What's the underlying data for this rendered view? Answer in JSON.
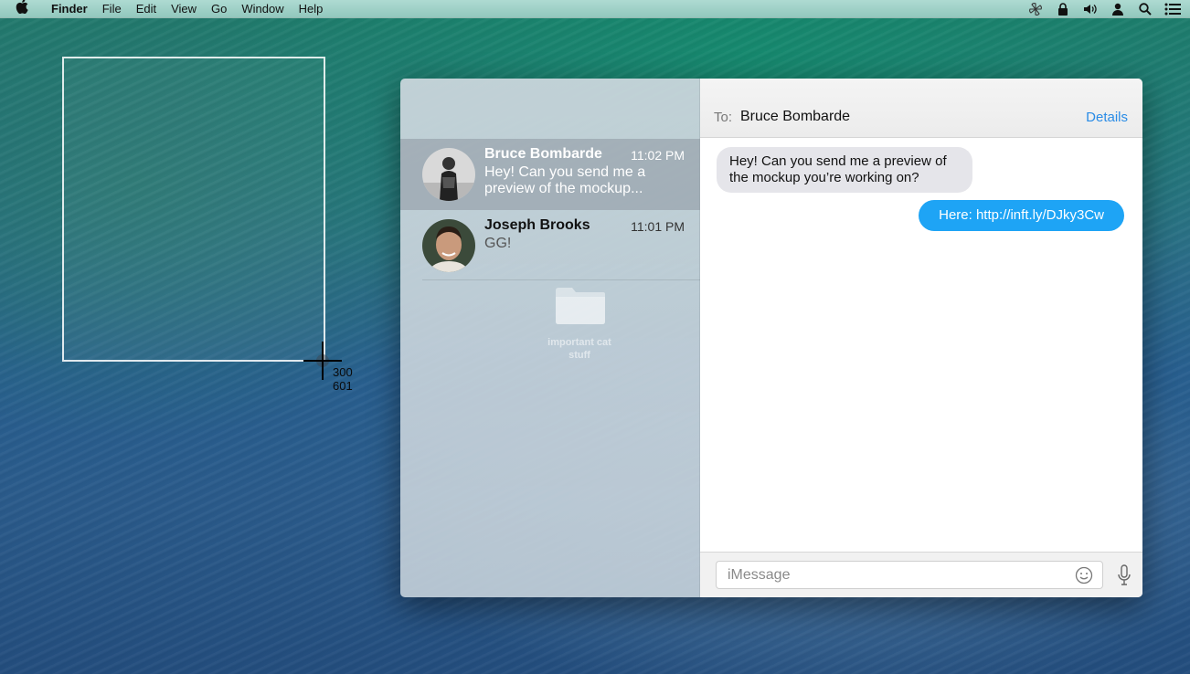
{
  "menubar": {
    "app_name": "Finder",
    "items": [
      "File",
      "Edit",
      "View",
      "Go",
      "Window",
      "Help"
    ],
    "status_icons": [
      "pinwheel-icon",
      "lock-icon",
      "volume-icon",
      "user-icon",
      "spotlight-icon",
      "notification-center-icon"
    ]
  },
  "screenshot_tool": {
    "coord_x": "300",
    "coord_y": "601"
  },
  "desktop": {
    "folder_label": "important cat stuff"
  },
  "messages": {
    "conversations": [
      {
        "name": "Bruce Bombarde",
        "time": "11:02 PM",
        "preview": "Hey! Can you send me a preview of the mockup...",
        "selected": true
      },
      {
        "name": "Joseph Brooks",
        "time": "11:01 PM",
        "preview": "GG!",
        "selected": false
      }
    ],
    "header": {
      "to_label": "To:",
      "recipient": "Bruce Bombarde",
      "details_label": "Details"
    },
    "thread": [
      {
        "direction": "incoming",
        "text": "Hey! Can you send me a preview of the mockup you’re working on?"
      },
      {
        "direction": "outgoing",
        "text": "Here: http://inft.ly/DJky3Cw"
      }
    ],
    "composer": {
      "placeholder": "iMessage"
    }
  },
  "colors": {
    "accent": "#2a8ce6",
    "outgoing_bubble": "#1ea4f5",
    "incoming_bubble": "#e5e5ea"
  }
}
